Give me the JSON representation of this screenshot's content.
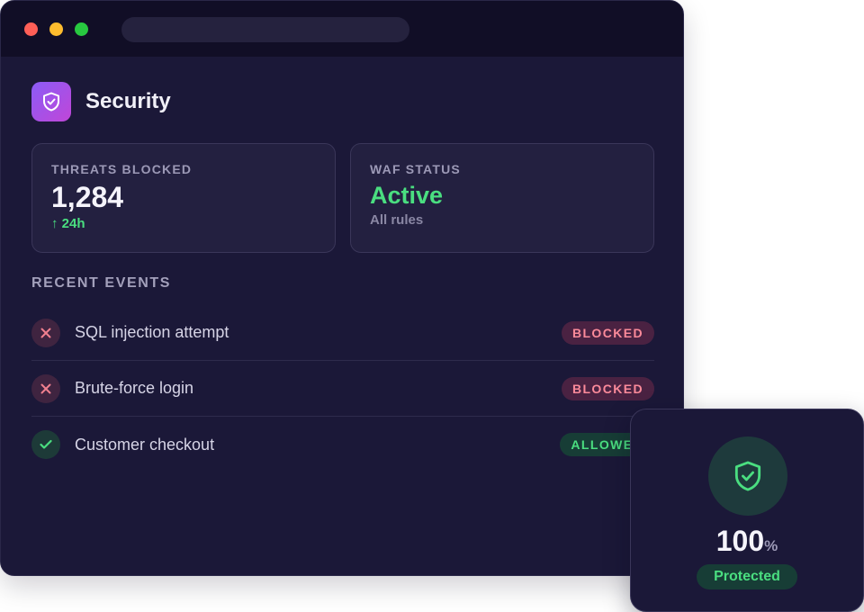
{
  "window": {
    "controls": [
      "close",
      "minimize",
      "maximize"
    ]
  },
  "app": {
    "title": "Security",
    "icon": "shield-check-icon"
  },
  "stats": {
    "threats": {
      "label": "THREATS BLOCKED",
      "value": "1,284",
      "trend_arrow": "↑",
      "trend": "24h"
    },
    "waf": {
      "label": "WAF STATUS",
      "value": "Active",
      "sub": "All rules"
    }
  },
  "events": {
    "title": "RECENT EVENTS",
    "items": [
      {
        "label": "SQL injection attempt",
        "status": "BLOCKED",
        "icon": "x-icon"
      },
      {
        "label": "Brute-force login",
        "status": "BLOCKED",
        "icon": "x-icon"
      },
      {
        "label": "Customer checkout",
        "status": "ALLOWED",
        "icon": "check-icon"
      }
    ]
  },
  "protection": {
    "value": "100",
    "unit": "%",
    "status": "Protected",
    "icon": "shield-check-icon"
  },
  "colors": {
    "accent_green": "#4ade80",
    "blocked_red": "#fb8a9a",
    "brand_purple": "#8b5cf6"
  }
}
